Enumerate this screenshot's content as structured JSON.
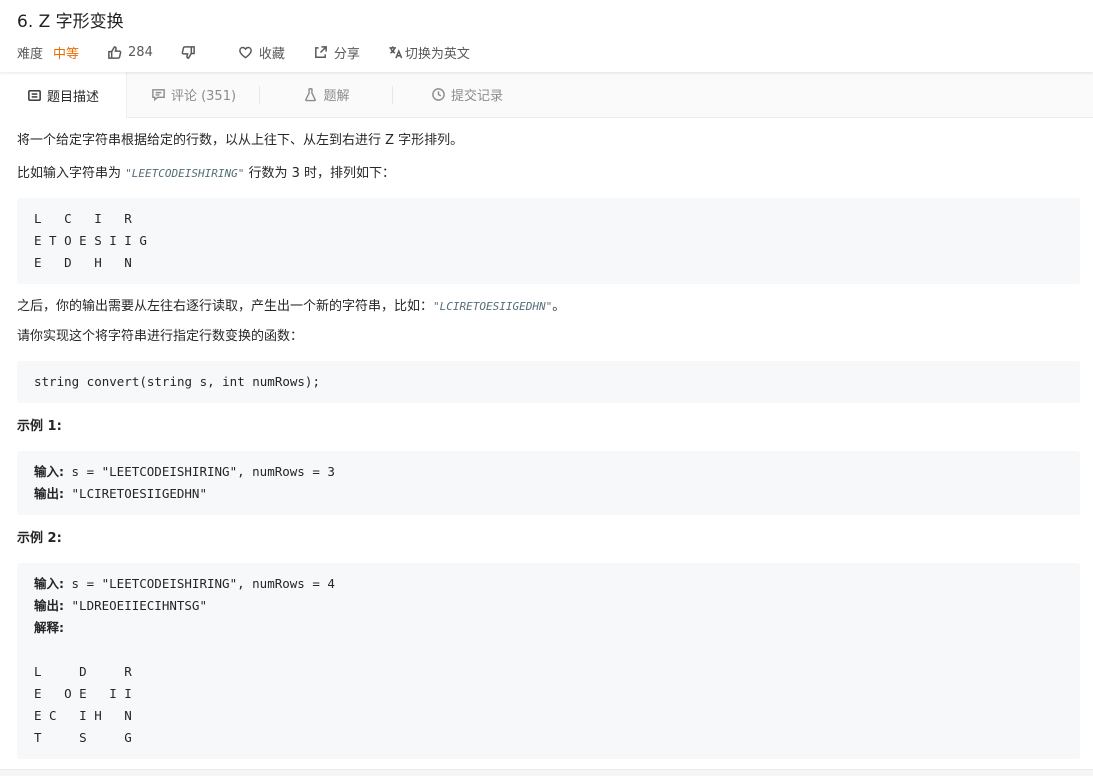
{
  "header": {
    "title": "6. Z 字形变换",
    "difficulty_label": "难度",
    "difficulty_value": "中等",
    "likes": "284",
    "favorite_label": "收藏",
    "share_label": "分享",
    "switch_lang_label": "切换为英文"
  },
  "tabs": [
    {
      "label": "题目描述"
    },
    {
      "label": "评论 (351)"
    },
    {
      "label": "题解"
    },
    {
      "label": "提交记录"
    }
  ],
  "description": {
    "p1": "将一个给定字符串根据给定的行数，以从上往下、从左到右进行 Z 字形排列。",
    "p2_before": "比如输入字符串为 ",
    "p2_code": "\"LEETCODEISHIRING\"",
    "p2_after": " 行数为 3 时，排列如下：",
    "zigzag_block": "L   C   I   R\nE T O E S I I G\nE   D   H   N",
    "p3_before": "之后，你的输出需要从左往右逐行读取，产生出一个新的字符串，比如：",
    "p3_code": "\"LCIRETOESIIGEDHN\"",
    "p3_after": "。",
    "p4": "请你实现这个将字符串进行指定行数变换的函数：",
    "signature_block": "string convert(string s, int numRows);"
  },
  "examples": [
    {
      "title": "示例 1:",
      "input_label": "输入:",
      "input_value": " s = \"LEETCODEISHIRING\", numRows = 3",
      "output_label": "输出:",
      "output_value": " \"LCIRETOESIIGEDHN\""
    },
    {
      "title": "示例 2:",
      "input_label": "输入:",
      "input_value": " s = \"LEETCODEISHIRING\", numRows = 4",
      "output_label": "输出:",
      "output_value": " \"LDREOEIIECIHNTSG\"",
      "explain_label": "解释:",
      "explain_block": "L     D     R\nE   O E   I I\nE C   I H   N\nT     S     G"
    }
  ]
}
